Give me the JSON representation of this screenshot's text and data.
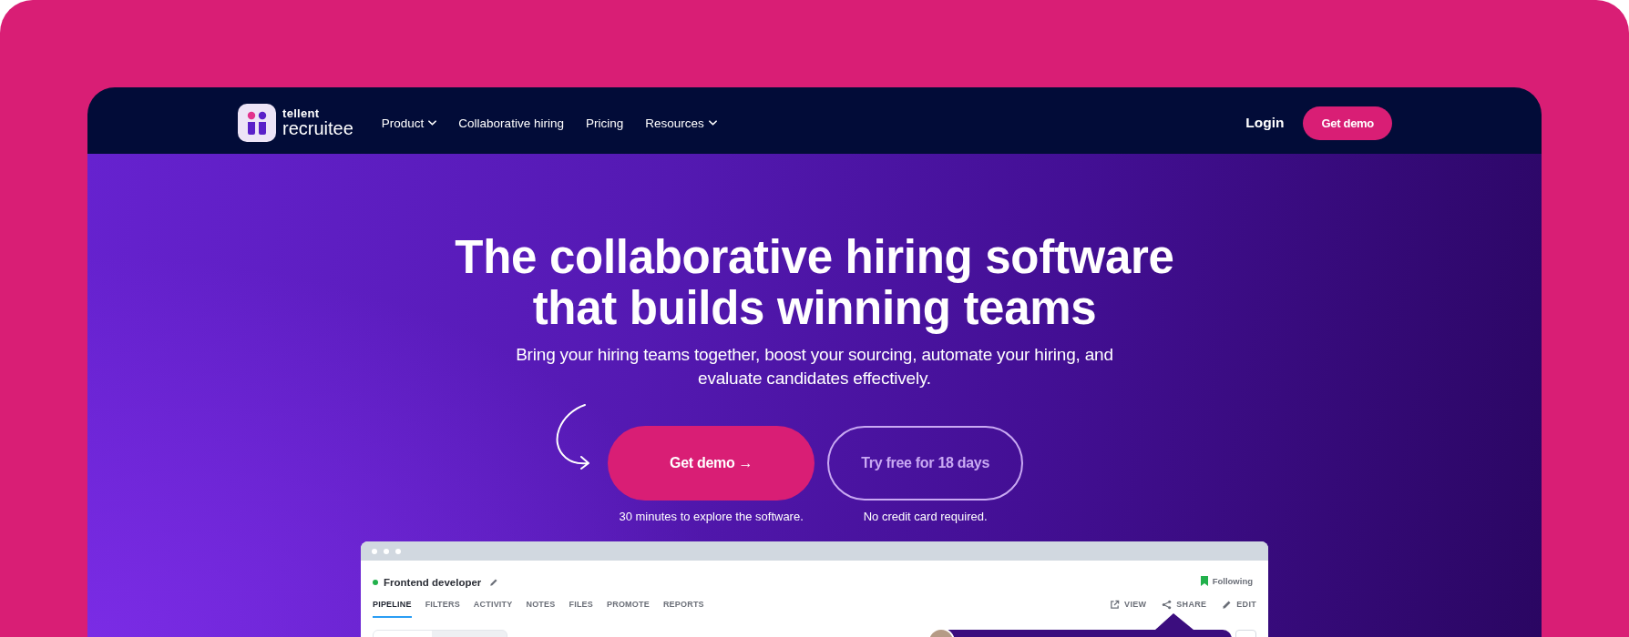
{
  "nav": {
    "logo": {
      "tagline": "tellent",
      "name": "recruitee"
    },
    "items": [
      {
        "label": "Product",
        "dropdown": true
      },
      {
        "label": "Collaborative hiring",
        "dropdown": false
      },
      {
        "label": "Pricing",
        "dropdown": false
      },
      {
        "label": "Resources",
        "dropdown": true
      }
    ],
    "login": "Login",
    "cta": "Get demo"
  },
  "hero": {
    "title": "The collaborative hiring software that builds winning teams",
    "subtitle": "Bring your hiring teams together, boost your sourcing, automate your hiring, and evaluate candidates effectively.",
    "actions": [
      {
        "kind": "primary",
        "label": "Get demo →",
        "caption": "30 minutes to explore the software."
      },
      {
        "kind": "outline",
        "label": "Try free for 18 days",
        "caption": "No credit card required."
      }
    ]
  },
  "app_preview": {
    "job_title": "Frontend developer",
    "following": "Following",
    "tabs": [
      {
        "label": "PIPELINE",
        "selected": true
      },
      {
        "label": "FILTERS",
        "selected": false
      },
      {
        "label": "ACTIVITY",
        "selected": false
      },
      {
        "label": "NOTES",
        "selected": false
      },
      {
        "label": "FILES",
        "selected": false
      },
      {
        "label": "PROMOTE",
        "selected": false
      },
      {
        "label": "REPORTS",
        "selected": false
      }
    ],
    "actions": [
      {
        "kind": "view",
        "label": "VIEW"
      },
      {
        "kind": "share",
        "label": "SHARE"
      },
      {
        "kind": "edit",
        "label": "EDIT"
      }
    ]
  }
}
